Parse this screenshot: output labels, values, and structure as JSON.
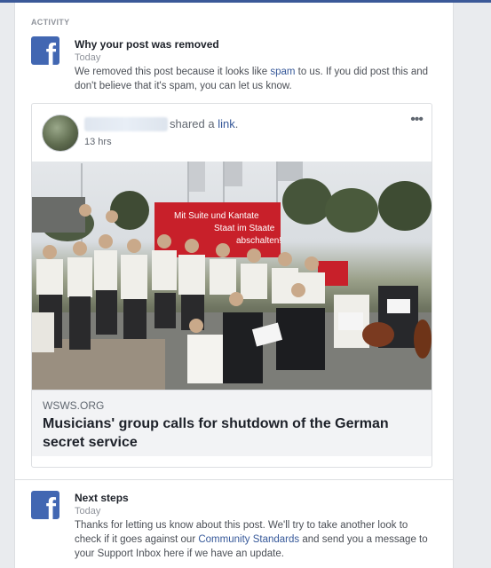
{
  "section": {
    "label": "ACTIVITY"
  },
  "notifications": [
    {
      "title": "Why your post was removed",
      "time": "Today",
      "body_before": "We removed this post because it looks like ",
      "body_link": "spam",
      "body_after": " to us. If you did post this and don't believe that it's spam, you can let us know."
    },
    {
      "title": "Next steps",
      "time": "Today",
      "body_before": "Thanks for letting us know about this post. We'll try to take another look to check if it goes against our ",
      "body_link": "Community Standards",
      "body_after": " and send you a message to your Support Inbox here if we have an update."
    }
  ],
  "post": {
    "shared_prefix": "shared a ",
    "shared_link": "link",
    "shared_suffix": ".",
    "time": "13 hrs",
    "more_label": "•••",
    "banner_line1": "Mit Suite und Kantate",
    "banner_line2": "Staat im Staate",
    "banner_line3": "abschalten!",
    "domain": "WSWS.ORG",
    "headline": "Musicians' group calls for shutdown of the German secret service"
  },
  "icons": {
    "facebook": "facebook-logo-icon",
    "more": "more-options-icon"
  },
  "colors": {
    "brand": "#4267b2",
    "link": "#365899",
    "text_secondary": "#90949c"
  }
}
